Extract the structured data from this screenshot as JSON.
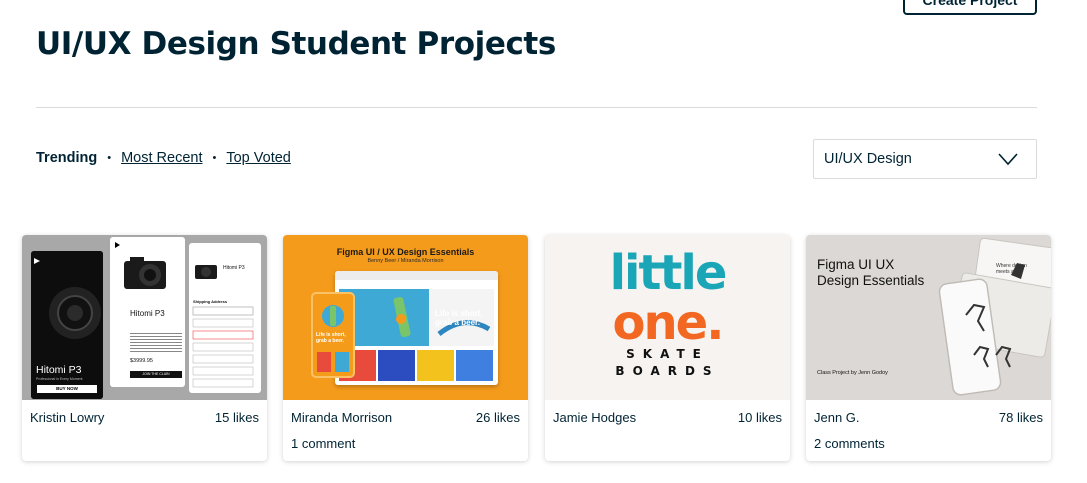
{
  "header": {
    "create_button": "Create Project",
    "title": "UI/UX Design Student Projects"
  },
  "sort": {
    "trending": "Trending",
    "most_recent": "Most Recent",
    "top_voted": "Top Voted"
  },
  "filter": {
    "selected": "UI/UX Design"
  },
  "projects": [
    {
      "author": "Kristin Lowry",
      "likes": "15 likes",
      "comments": "",
      "thumb": {
        "brand": "Hitomi P3",
        "tagline": "Professional in Every Moment",
        "cta": "BUY NOW",
        "price": "$3999.95",
        "join": "JOIN THE CLUB!",
        "checkout_title": "Shipping Address"
      }
    },
    {
      "author": "Miranda Morrison",
      "likes": "26 likes",
      "comments": "1 comment",
      "thumb": {
        "title": "Figma UI / UX Design Essentials",
        "subtitle": "Benny Beer / Miranda Morrison",
        "hero_text": "Life is short, grab a beer.",
        "mobile_text": "Life is short, grab a beer."
      }
    },
    {
      "author": "Jamie Hodges",
      "likes": "10 likes",
      "comments": "",
      "thumb": {
        "line1": "little",
        "line2": "one.",
        "line3": "SKATE",
        "line4": "BOARDS"
      }
    },
    {
      "author": "Jenn G.",
      "likes": "78 likes",
      "comments": "2 comments",
      "thumb": {
        "title": "Figma UI UX\nDesign Essentials",
        "credit": "Class Project by Jenn Godoy",
        "hero": "Where design meets art"
      }
    }
  ],
  "colors": {
    "text": "#002333",
    "border": "#d9dbdd",
    "card_orange": "#f59b1b",
    "skate_teal": "#1aa6b7",
    "skate_orange": "#f26722"
  }
}
